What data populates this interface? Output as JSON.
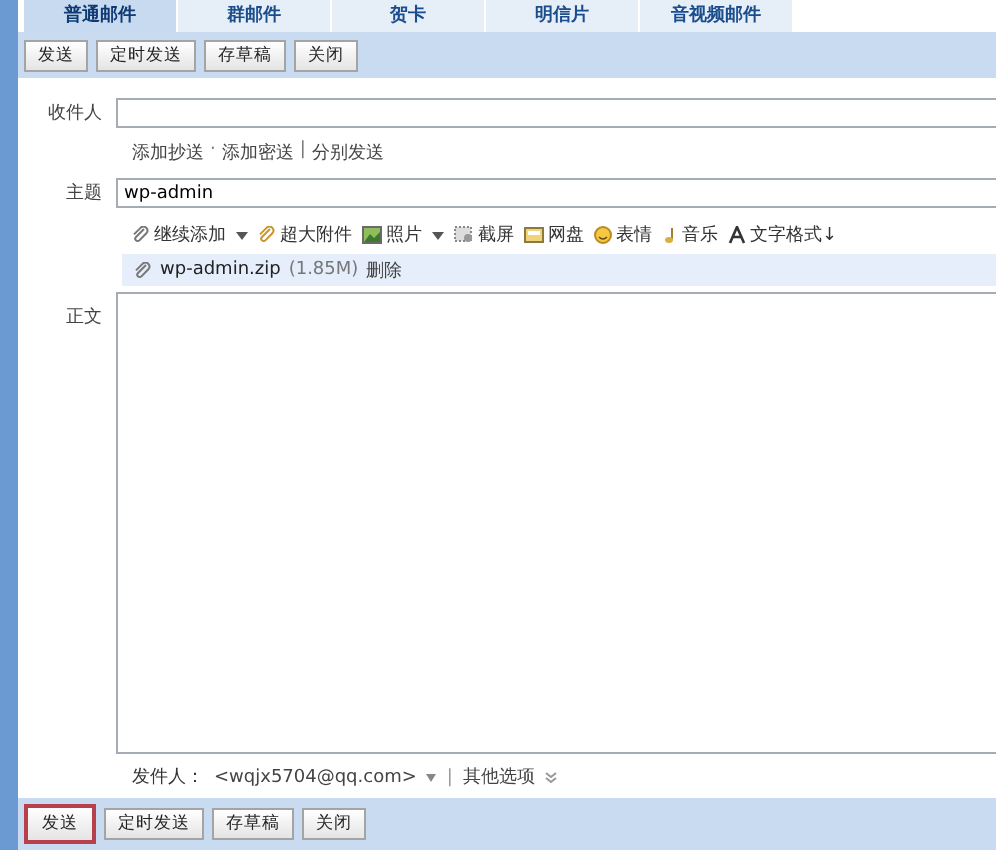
{
  "tabs": [
    {
      "label": "普通邮件",
      "selected": true
    },
    {
      "label": "群邮件",
      "selected": false
    },
    {
      "label": "贺卡",
      "selected": false
    },
    {
      "label": "明信片",
      "selected": false
    },
    {
      "label": "音视频邮件",
      "selected": false
    }
  ],
  "top_toolbar": [
    {
      "label": "发送",
      "highlighted": false
    },
    {
      "label": "定时发送",
      "highlighted": false
    },
    {
      "label": "存草稿",
      "highlighted": false
    },
    {
      "label": "关闭",
      "highlighted": false
    }
  ],
  "recipient": {
    "label": "收件人"
  },
  "recipient_links": [
    {
      "label": "添加抄送",
      "separator": "·"
    },
    {
      "label": "添加密送",
      "separator": "|"
    },
    {
      "label": "分别发送"
    }
  ],
  "subject": {
    "label": "主题",
    "value": "wp-admin"
  },
  "attach_toolbar": [
    {
      "kind": "clip",
      "label": "继续添加",
      "dropdown": true
    },
    {
      "kind": "bigclip",
      "label": "超大附件",
      "dropdown": false
    },
    {
      "kind": "photo",
      "label": "照片",
      "dropdown": true
    },
    {
      "kind": "screenshot",
      "label": "截屏",
      "dropdown": false
    },
    {
      "kind": "disk",
      "label": "网盘",
      "dropdown": false
    },
    {
      "kind": "emoji",
      "label": "表情",
      "dropdown": false
    },
    {
      "kind": "music",
      "label": "音乐",
      "dropdown": false
    },
    {
      "kind": "format",
      "label": "文字格式↓",
      "dropdown": false
    }
  ],
  "attachment": {
    "name": "wp-admin.zip",
    "size": "(1.85M)",
    "remove": "删除"
  },
  "body": {
    "label": "正文"
  },
  "sender": {
    "label": "发件人：",
    "value": "<wqjx5704@qq.com>",
    "separator": "|",
    "more": "其他选项"
  },
  "bottom_toolbar": [
    {
      "label": "发送",
      "highlighted": true
    },
    {
      "label": "定时发送",
      "highlighted": false
    },
    {
      "label": "存草稿",
      "highlighted": false
    },
    {
      "label": "关闭",
      "highlighted": false
    }
  ]
}
